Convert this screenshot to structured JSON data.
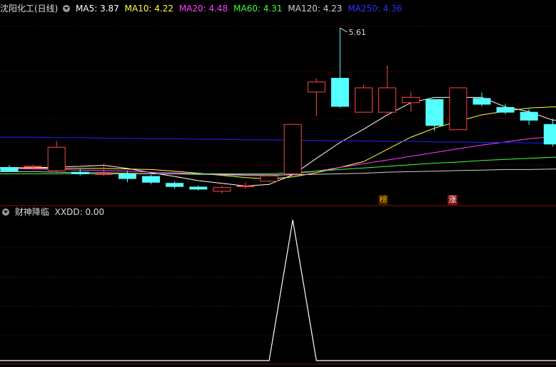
{
  "colors": {
    "background": "#000000",
    "up": "#ff4444",
    "down": "#54ffff",
    "grid": "#8a1010",
    "ma5": "#ffffff",
    "ma10": "#ffff40",
    "ma20": "#ff40ff",
    "ma60": "#40ff40",
    "ma120": "#d0d0d0",
    "ma250": "#2020ff"
  },
  "main": {
    "title": "沈阳化工(日线)",
    "ma_labels": [
      {
        "text": "MA5: 3.87",
        "color": "#ffffff"
      },
      {
        "text": "MA10: 4.22",
        "color": "#ffff40"
      },
      {
        "text": "MA20: 4.48",
        "color": "#ff40ff"
      },
      {
        "text": "MA60: 4.31",
        "color": "#40ff40"
      },
      {
        "text": "MA120: 4.23",
        "color": "#d0d0d0"
      },
      {
        "text": "MA250: 4.36",
        "color": "#3030ff"
      }
    ],
    "high_label": "5.61",
    "badge_bang": "榜",
    "badge_zhang": "涨"
  },
  "sub": {
    "title": "财神降临",
    "indicator": "XXDD: 0.00"
  },
  "chart_data": [
    {
      "type": "candlestick",
      "title": "沈阳化工(日线)",
      "ylim": [
        2.3,
        6.0
      ],
      "candles": [
        {
          "o": 2.98,
          "h": 3.02,
          "l": 2.9,
          "c": 2.91
        },
        {
          "o": 3.0,
          "h": 3.03,
          "l": 2.95,
          "c": 3.0
        },
        {
          "o": 2.92,
          "h": 3.48,
          "l": 2.9,
          "c": 3.36
        },
        {
          "o": 2.89,
          "h": 2.95,
          "l": 2.83,
          "c": 2.86
        },
        {
          "o": 2.86,
          "h": 3.05,
          "l": 2.82,
          "c": 2.86
        },
        {
          "o": 2.85,
          "h": 2.92,
          "l": 2.7,
          "c": 2.77
        },
        {
          "o": 2.81,
          "h": 2.84,
          "l": 2.66,
          "c": 2.7
        },
        {
          "o": 2.68,
          "h": 2.72,
          "l": 2.58,
          "c": 2.62
        },
        {
          "o": 2.61,
          "h": 2.64,
          "l": 2.55,
          "c": 2.57
        },
        {
          "o": 2.53,
          "h": 2.64,
          "l": 2.49,
          "c": 2.6
        },
        {
          "o": 2.62,
          "h": 2.7,
          "l": 2.58,
          "c": 2.63
        },
        {
          "o": 2.72,
          "h": 2.85,
          "l": 2.7,
          "c": 2.82
        },
        {
          "o": 2.86,
          "h": 3.79,
          "l": 2.84,
          "c": 3.79
        },
        {
          "o": 4.4,
          "h": 4.66,
          "l": 3.95,
          "c": 4.59
        },
        {
          "o": 4.66,
          "h": 5.61,
          "l": 4.1,
          "c": 4.13
        },
        {
          "o": 4.02,
          "h": 4.54,
          "l": 4.02,
          "c": 4.48
        },
        {
          "o": 4.02,
          "h": 4.9,
          "l": 4.0,
          "c": 4.48
        },
        {
          "o": 4.2,
          "h": 4.41,
          "l": 4.03,
          "c": 4.3
        },
        {
          "o": 4.26,
          "h": 4.26,
          "l": 3.66,
          "c": 3.77
        },
        {
          "o": 3.69,
          "h": 4.48,
          "l": 3.69,
          "c": 4.48
        },
        {
          "o": 4.28,
          "h": 4.39,
          "l": 4.13,
          "c": 4.17
        },
        {
          "o": 4.11,
          "h": 4.18,
          "l": 3.98,
          "c": 4.02
        },
        {
          "o": 4.02,
          "h": 4.08,
          "l": 3.78,
          "c": 3.87
        },
        {
          "o": 3.79,
          "h": 3.9,
          "l": 3.37,
          "c": 3.42
        }
      ],
      "ma_lines": [
        {
          "name": "MA5",
          "color": "#ffffff",
          "values": [
            2.97,
            2.97,
            2.99,
            3.0,
            3.02,
            2.96,
            2.88,
            2.81,
            2.73,
            2.68,
            2.63,
            2.66,
            2.84,
            3.15,
            3.45,
            3.7,
            3.97,
            4.2,
            4.3,
            4.3,
            4.3,
            4.12,
            4.03,
            3.87
          ]
        },
        {
          "name": "MA10",
          "color": "#ffff40",
          "values": [
            2.98,
            2.97,
            2.96,
            2.96,
            2.96,
            2.95,
            2.94,
            2.91,
            2.87,
            2.83,
            2.79,
            2.76,
            2.8,
            2.88,
            2.98,
            3.09,
            3.32,
            3.55,
            3.72,
            3.85,
            3.97,
            4.04,
            4.1,
            4.12
          ]
        },
        {
          "name": "MA20",
          "color": "#ff40ff",
          "values": [
            2.96,
            2.95,
            2.94,
            2.93,
            2.92,
            2.91,
            2.89,
            2.88,
            2.86,
            2.84,
            2.83,
            2.82,
            2.85,
            2.91,
            2.98,
            3.05,
            3.12,
            3.19,
            3.26,
            3.33,
            3.4,
            3.46,
            3.52,
            3.56
          ]
        },
        {
          "name": "MA60",
          "color": "#40ff40",
          "values": [
            2.86,
            2.86,
            2.86,
            2.86,
            2.86,
            2.86,
            2.86,
            2.86,
            2.86,
            2.86,
            2.86,
            2.86,
            2.88,
            2.91,
            2.94,
            2.97,
            3.0,
            3.03,
            3.06,
            3.08,
            3.11,
            3.13,
            3.15,
            3.17
          ]
        },
        {
          "name": "MA120",
          "color": "#d0d0d0",
          "values": [
            2.9,
            2.9,
            2.89,
            2.88,
            2.88,
            2.87,
            2.86,
            2.86,
            2.85,
            2.85,
            2.84,
            2.84,
            2.84,
            2.85,
            2.86,
            2.87,
            2.89,
            2.9,
            2.91,
            2.92,
            2.93,
            2.94,
            2.94,
            2.95
          ]
        },
        {
          "name": "MA250",
          "color": "#2020ff",
          "values": [
            3.55,
            3.55,
            3.54,
            3.54,
            3.53,
            3.53,
            3.52,
            3.52,
            3.51,
            3.51,
            3.5,
            3.5,
            3.49,
            3.49,
            3.48,
            3.48,
            3.47,
            3.47,
            3.46,
            3.46,
            3.45,
            3.45,
            3.44,
            3.44
          ]
        }
      ],
      "max_price": 5.61
    },
    {
      "type": "line",
      "title": "财神降临",
      "ylim": [
        0,
        1
      ],
      "series": [
        {
          "name": "XXDD",
          "values": [
            0,
            0,
            0,
            0,
            0,
            0,
            0,
            0,
            0,
            0,
            0,
            0,
            1,
            0,
            0,
            0,
            0,
            0,
            0,
            0,
            0,
            0,
            0,
            0
          ]
        }
      ]
    }
  ]
}
